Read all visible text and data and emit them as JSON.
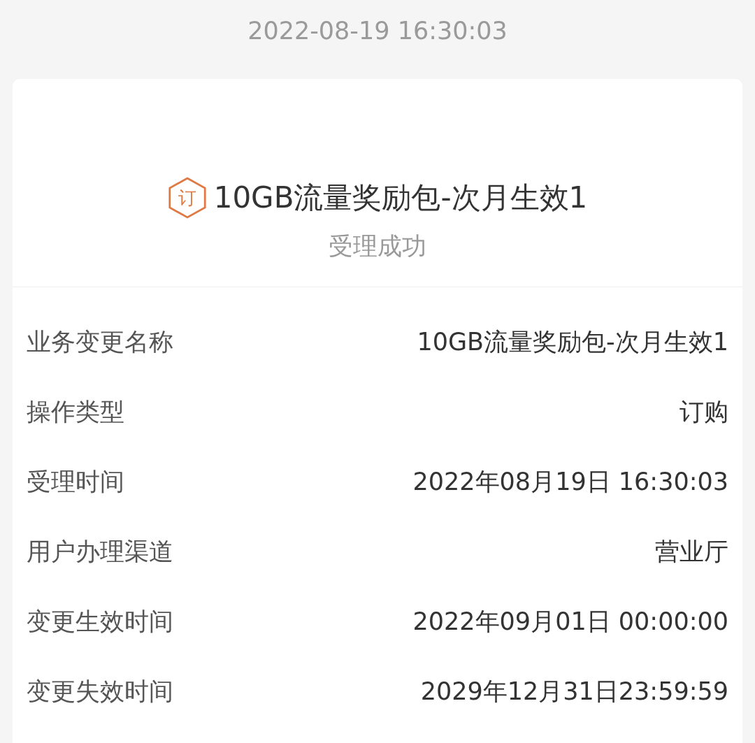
{
  "timestamp": "2022-08-19 16:30:03",
  "card": {
    "badge": "订",
    "title": "10GB流量奖励包-次月生效1",
    "status": "受理成功",
    "details": [
      {
        "label": "业务变更名称",
        "value": "10GB流量奖励包-次月生效1"
      },
      {
        "label": "操作类型",
        "value": "订购"
      },
      {
        "label": "受理时间",
        "value": "2022年08月19日 16:30:03"
      },
      {
        "label": "用户办理渠道",
        "value": "营业厅"
      },
      {
        "label": "变更生效时间",
        "value": "2022年09月01日 00:00:00"
      },
      {
        "label": "变更失效时间",
        "value": "2029年12月31日23:59:59"
      }
    ]
  }
}
